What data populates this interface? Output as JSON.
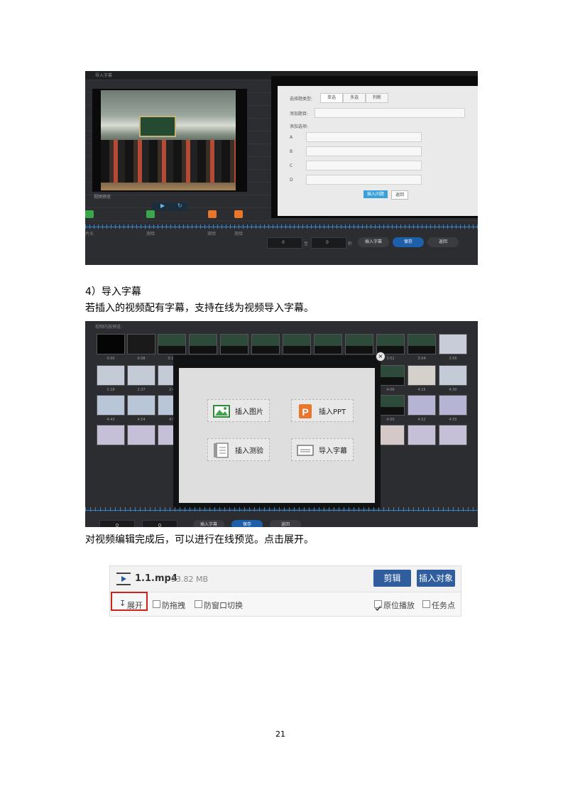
{
  "screenshot1": {
    "title": "导入字幕",
    "video_caption": "视频预览",
    "play_icons": [
      "▶",
      "↻"
    ],
    "panel": {
      "question_type_label": "选择题类型:",
      "tabs": [
        "单选",
        "多选",
        "判断"
      ],
      "question_label": "添加题目:",
      "options_label": "添加选项:",
      "option_letters": [
        "A",
        "B",
        "C",
        "D"
      ],
      "insert_button": "插入问题",
      "back_button": "返回"
    },
    "timeline_labels": [
      "片头",
      "测验",
      "测验",
      "测验"
    ],
    "bottom": {
      "start_value": "0",
      "to_label": "至",
      "end_value": "0",
      "unit": "秒",
      "insert_button": "插入字幕",
      "save_button": "保存",
      "back_button": "返回"
    },
    "marker_colors": [
      "#3aa64b",
      "#3aa64b",
      "#e8762b",
      "#e8762b"
    ]
  },
  "section_heading": "4）导入字幕",
  "section_desc": "若插入的视频配有字幕，支持在线为视频导入字幕。",
  "screenshot2": {
    "title": "视频内容预览:",
    "thumb_labels_row1": [
      "0:00",
      "0:08",
      "0:16"
    ],
    "thumb_labels_row2": [
      "2:18",
      "2:37",
      "2:4"
    ],
    "thumb_labels_right1": [
      "3:52",
      "3:54",
      "3:56"
    ],
    "thumb_labels_right2": [
      "4:06",
      "4:15",
      "4:30"
    ],
    "thumb_labels_right3": [
      "4:50",
      "4:52",
      "4:55"
    ],
    "thumb_labels_left3": [
      "4:43",
      "4:54",
      "4:5"
    ],
    "dialog": {
      "insert_image": "插入图片",
      "insert_ppt": "插入PPT",
      "insert_quiz": "插入测验",
      "import_subtitle": "导入字幕",
      "close_icon": "×"
    },
    "bottom": {
      "start_value": "0",
      "end_value": "0",
      "insert_button": "插入字幕",
      "save_button": "保存",
      "back_button": "返回"
    }
  },
  "after_text": "对视频编辑完成后，可以进行在线预览。点击展开。",
  "screenshot3": {
    "file_name": "1.1.mp4",
    "file_size": "53.82 MB",
    "edit_button": "剪辑",
    "insert_button": "插入对象",
    "expand_label": "展开",
    "options": [
      {
        "label": "防拖拽",
        "checked": false
      },
      {
        "label": "防窗口切换",
        "checked": false
      },
      {
        "label": "原位播放",
        "checked": true
      },
      {
        "label": "任务点",
        "checked": false
      }
    ]
  },
  "page_number": "21"
}
